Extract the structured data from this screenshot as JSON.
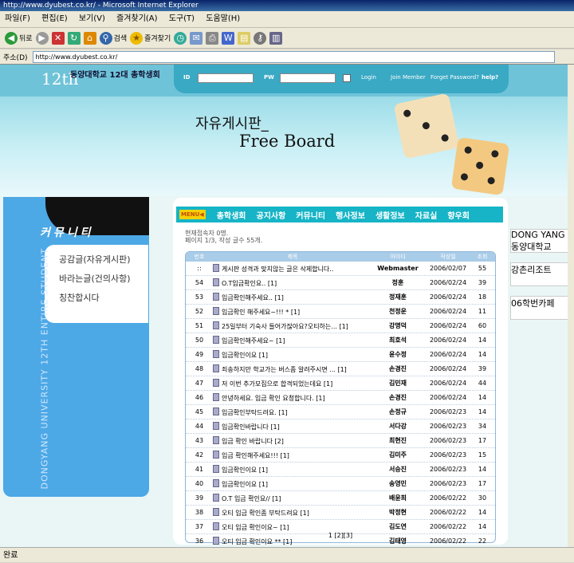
{
  "browser": {
    "title": "http://www.dyubest.co.kr/ - Microsoft Internet Explorer",
    "menu": [
      "파일(F)",
      "편집(E)",
      "보기(V)",
      "즐겨찾기(A)",
      "도구(T)",
      "도움말(H)"
    ],
    "back_label": "뒤로",
    "search_label": "검색",
    "favorites_label": "즐겨찾기",
    "address_label": "주소(D)",
    "address": "http://www.dyubest.co.kr/",
    "status": "완료"
  },
  "header": {
    "logo": "12th",
    "slogan": "동양대학교 12대 총학생회",
    "board_title": "자유게시판_",
    "board_en": "Free Board",
    "login": {
      "id_label": "ID",
      "pw_label": "PW",
      "login": "Login",
      "join": "Join Member",
      "forgot": "Forget Password?",
      "help": "help?"
    }
  },
  "sidebar": {
    "section": "커뮤니티",
    "items": [
      "공감글(자유게시판)",
      "바라는글(건의사항)",
      "칭찬합시다"
    ],
    "vertical_text": "DONGYANG UNIVERSITY 12TH ENTIRE STUDENT"
  },
  "nav": {
    "tag": "MENU◀",
    "items": [
      "총학생회",
      "공지사항",
      "커뮤니티",
      "행사정보",
      "생활정보",
      "자료실",
      "향우회"
    ]
  },
  "meta": {
    "online": "현재접속자 0명.",
    "count": "페이지 1/3, 작성 글수 55개."
  },
  "table": {
    "headers": [
      "번호",
      "제목",
      "아이디",
      "작성일",
      "조회"
    ],
    "rows": [
      [
        "::",
        "게시판 성격과 맞지않는 글은 삭제합니다..",
        "Webmaster",
        "2006/02/07",
        "55"
      ],
      [
        "54",
        "O.T입금확인요.. [1]",
        "정훈",
        "2006/02/24",
        "39"
      ],
      [
        "53",
        "입금확인해주세요.. [1]",
        "정재훈",
        "2006/02/24",
        "18"
      ],
      [
        "52",
        "입금확인 해주세요~!!! * [1]",
        "천정운",
        "2006/02/24",
        "11"
      ],
      [
        "51",
        "25일부터 기숙사 들어가잖아요?오티하는... [1]",
        "강명덕",
        "2006/02/24",
        "60"
      ],
      [
        "50",
        "입금확인해주세요~ [1]",
        "최호석",
        "2006/02/24",
        "14"
      ],
      [
        "49",
        "입금확인이요 [1]",
        "윤수정",
        "2006/02/24",
        "14"
      ],
      [
        "48",
        "죄송하지만 학교가는 버스좀 알려주시면 ... [1]",
        "손경진",
        "2006/02/24",
        "39"
      ],
      [
        "47",
        "저 이번 추가모집으로 합격되었는데요 [1]",
        "김민재",
        "2006/02/24",
        "44"
      ],
      [
        "46",
        "안녕하세요. 입금 확인 요청합니다. [1]",
        "손경진",
        "2006/02/24",
        "14"
      ],
      [
        "45",
        "입금확인부탁드려요. [1]",
        "손정규",
        "2006/02/23",
        "14"
      ],
      [
        "44",
        "입금확인바랍니다 [1]",
        "서다강",
        "2006/02/23",
        "34"
      ],
      [
        "43",
        "입금 확인 바랍니다 [2]",
        "최현진",
        "2006/02/23",
        "17"
      ],
      [
        "42",
        "입금 확인해주세요!!! [1]",
        "김미주",
        "2006/02/23",
        "15"
      ],
      [
        "41",
        "입금확인이요 [1]",
        "서승진",
        "2006/02/23",
        "14"
      ],
      [
        "40",
        "입금확인이요 [1]",
        "송영민",
        "2006/02/23",
        "17"
      ],
      [
        "39",
        "O.T 입금 확인요// [1]",
        "배윤희",
        "2006/02/22",
        "30"
      ],
      [
        "38",
        "오티 입금 확인좀 부탁드려요 [1]",
        "박정현",
        "2006/02/22",
        "14"
      ],
      [
        "37",
        "오티 입금 확인이요~ [1]",
        "김도연",
        "2006/02/22",
        "14"
      ],
      [
        "36",
        "오티 입금 확인이요 ** [1]",
        "김태영",
        "2006/02/22",
        "22"
      ]
    ],
    "pager": "1 [2][3]"
  },
  "ads": [
    "DONG YANG 동양대학교",
    "강촌리조트",
    "06학번카페"
  ]
}
